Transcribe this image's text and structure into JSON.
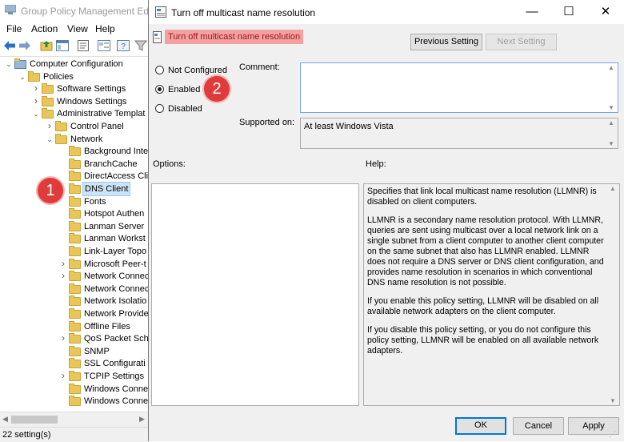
{
  "editor": {
    "title": "Group Policy Management Editor",
    "menu": [
      "File",
      "Action",
      "View",
      "Help"
    ],
    "tree": [
      {
        "label": "Computer Configuration",
        "level": 0,
        "expander": "open",
        "icon": "computer-icon"
      },
      {
        "label": "Policies",
        "level": 1,
        "expander": "open"
      },
      {
        "label": "Software Settings",
        "level": 2,
        "expander": "closed"
      },
      {
        "label": "Windows Settings",
        "level": 2,
        "expander": "closed"
      },
      {
        "label": "Administrative Templat",
        "level": 2,
        "expander": "open"
      },
      {
        "label": "Control Panel",
        "level": 3,
        "expander": "closed"
      },
      {
        "label": "Network",
        "level": 3,
        "expander": "open"
      },
      {
        "label": "Background Inte",
        "level": 4,
        "expander": "none"
      },
      {
        "label": "BranchCache",
        "level": 4,
        "expander": "none"
      },
      {
        "label": "DirectAccess Cli",
        "level": 4,
        "expander": "none"
      },
      {
        "label": "DNS Client",
        "level": 4,
        "expander": "none",
        "selected": true
      },
      {
        "label": "Fonts",
        "level": 4,
        "expander": "none"
      },
      {
        "label": "Hotspot Authen",
        "level": 4,
        "expander": "none"
      },
      {
        "label": "Lanman Server",
        "level": 4,
        "expander": "none"
      },
      {
        "label": "Lanman Workst",
        "level": 4,
        "expander": "none"
      },
      {
        "label": "Link-Layer Topo",
        "level": 4,
        "expander": "none"
      },
      {
        "label": "Microsoft Peer-t",
        "level": 4,
        "expander": "closed"
      },
      {
        "label": "Network Connec",
        "level": 4,
        "expander": "closed"
      },
      {
        "label": "Network Connec",
        "level": 4,
        "expander": "none"
      },
      {
        "label": "Network Isolatio",
        "level": 4,
        "expander": "none"
      },
      {
        "label": "Network Provide",
        "level": 4,
        "expander": "none"
      },
      {
        "label": "Offline Files",
        "level": 4,
        "expander": "none"
      },
      {
        "label": "QoS Packet Sche",
        "level": 4,
        "expander": "closed"
      },
      {
        "label": "SNMP",
        "level": 4,
        "expander": "none"
      },
      {
        "label": "SSL Configurati",
        "level": 4,
        "expander": "none"
      },
      {
        "label": "TCPIP Settings",
        "level": 4,
        "expander": "closed"
      },
      {
        "label": "Windows Conne",
        "level": 4,
        "expander": "none"
      },
      {
        "label": "Windows Conne",
        "level": 4,
        "expander": "none"
      }
    ],
    "status": "22 setting(s)"
  },
  "dialog": {
    "title": "Turn off multicast name resolution",
    "policy_name": "Turn off multicast name resolution",
    "prev_label": "Previous Setting",
    "next_label": "Next Setting",
    "radios": [
      {
        "label": "Not Configured",
        "checked": false
      },
      {
        "label": "Enabled",
        "checked": true
      },
      {
        "label": "Disabled",
        "checked": false
      }
    ],
    "comment_label": "Comment:",
    "comment_value": "",
    "supported_label": "Supported on:",
    "supported_value": "At least Windows Vista",
    "options_label": "Options:",
    "help_label": "Help:",
    "help_paragraphs": [
      "Specifies that link local multicast name resolution (LLMNR) is disabled on client computers.",
      "LLMNR is a secondary name resolution protocol. With LLMNR, queries are sent using multicast over a local network link on a single subnet from a client computer to another client computer on the same subnet that also has LLMNR enabled. LLMNR does not require a DNS server or DNS client configuration, and provides name resolution in scenarios in which conventional DNS name resolution is not possible.",
      "If you enable this policy setting, LLMNR will be disabled on all available network adapters on the client computer.",
      "If you disable this policy setting, or you do not configure this policy setting, LLMNR will be enabled on all available network adapters."
    ],
    "ok_label": "OK",
    "cancel_label": "Cancel",
    "apply_label": "Apply"
  },
  "annotations": {
    "step1": "1",
    "step2": "2"
  },
  "colors": {
    "highlight": "#f2a0a0",
    "badge": "#e03b3b",
    "accent": "#0078d7"
  }
}
